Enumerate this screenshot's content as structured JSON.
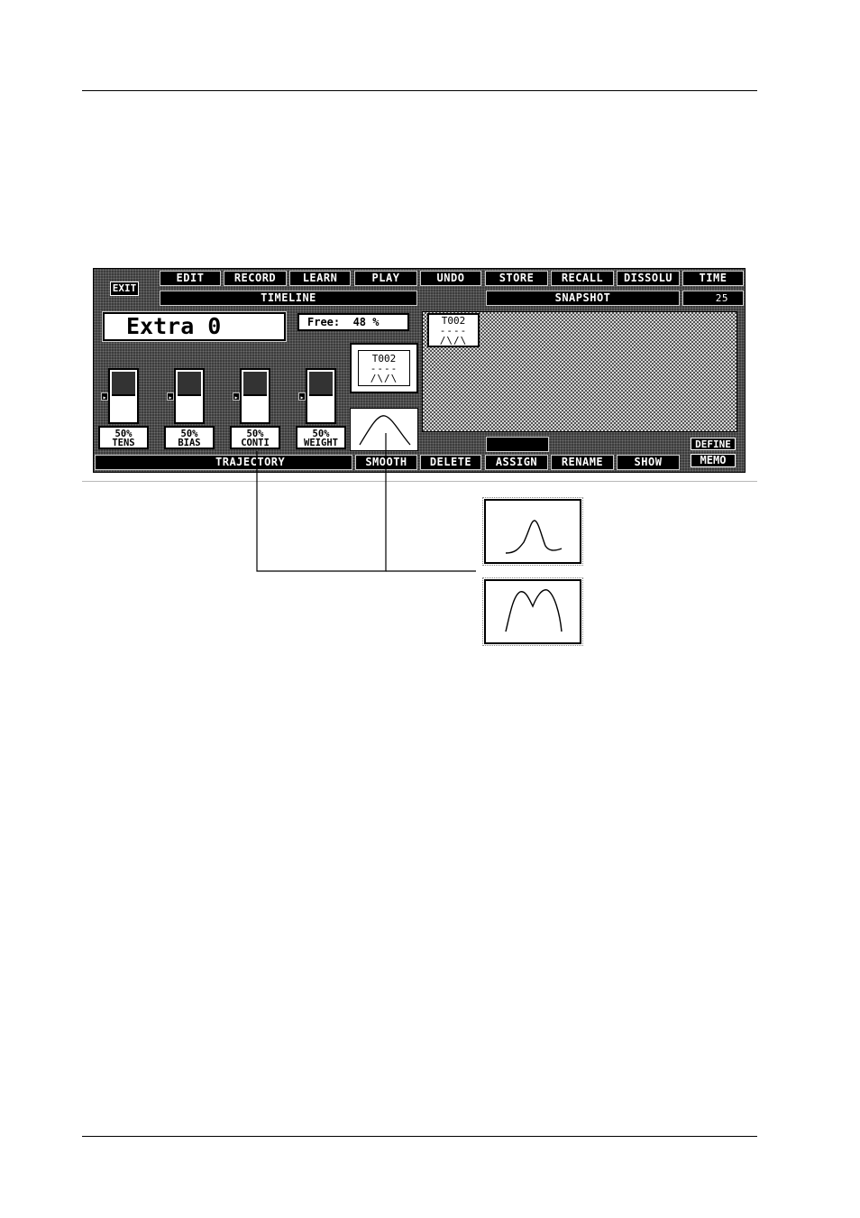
{
  "toolbar": {
    "exit": "EXIT",
    "edit": "EDIT",
    "record": "RECORD",
    "learn": "LEARN",
    "play": "PLAY",
    "undo": "UNDO",
    "store": "STORE",
    "recall": "RECALL",
    "dissolu": "DISSOLU",
    "time": "TIME",
    "timeline": "TIMELINE",
    "snapshot": "SNAPSHOT",
    "time_value": "25"
  },
  "cue": {
    "name": "Extra 0",
    "free_label": "Free:",
    "free_value": "48 %",
    "trajectory_code": "T002",
    "trajectory_dash": "----",
    "trajectory_shape": "/\\/\\"
  },
  "parameters": [
    {
      "value": "50%",
      "label": "TENS",
      "level": 0.5
    },
    {
      "value": "50%",
      "label": "BIAS",
      "level": 0.5
    },
    {
      "value": "50%",
      "label": "CONTI",
      "level": 0.5
    },
    {
      "value": "50%",
      "label": "WEIGHT",
      "level": 0.5
    }
  ],
  "snapshot_item": {
    "code": "T002",
    "dash": "----",
    "shape": "/\\/\\"
  },
  "bottom": {
    "trajectory": "TRAJECTORY",
    "smooth": "SMOOTH",
    "delete": "DELETE",
    "assign": "ASSIGN",
    "rename": "RENAME",
    "show": "SHOW",
    "define": "DEFINE",
    "memo": "MEMO"
  }
}
